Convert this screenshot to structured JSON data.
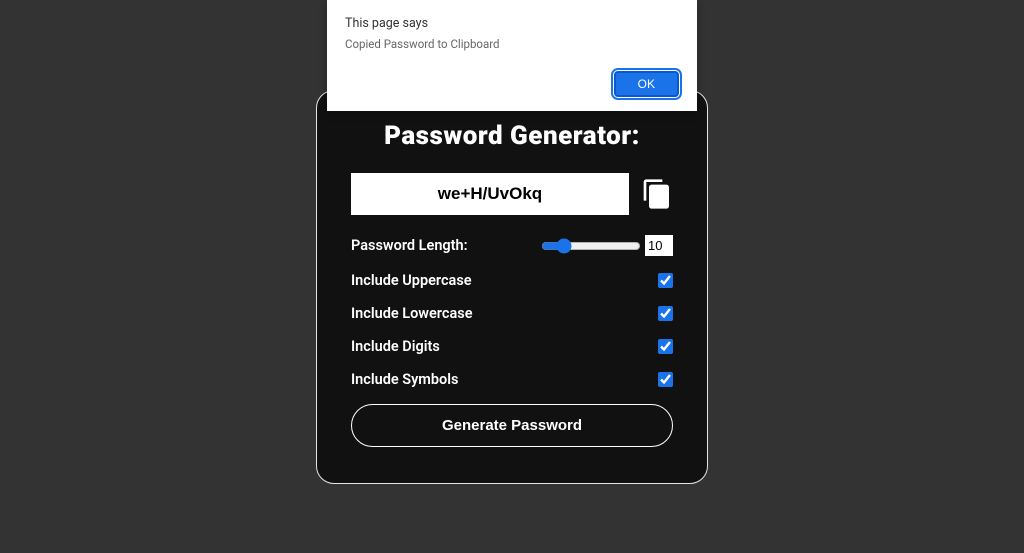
{
  "alert": {
    "title": "This page says",
    "message": "Copied Password to Clipboard",
    "ok_label": "OK"
  },
  "card": {
    "title": "Password Generator:",
    "password": "we+H/UvOkq",
    "length_label": "Password Length:",
    "length_value": "10",
    "slider_min": "1",
    "slider_max": "50",
    "options": {
      "uppercase_label": "Include Uppercase",
      "uppercase_checked": true,
      "lowercase_label": "Include Lowercase",
      "lowercase_checked": true,
      "digits_label": "Include Digits",
      "digits_checked": true,
      "symbols_label": "Include Symbols",
      "symbols_checked": true
    },
    "generate_label": "Generate Password"
  }
}
